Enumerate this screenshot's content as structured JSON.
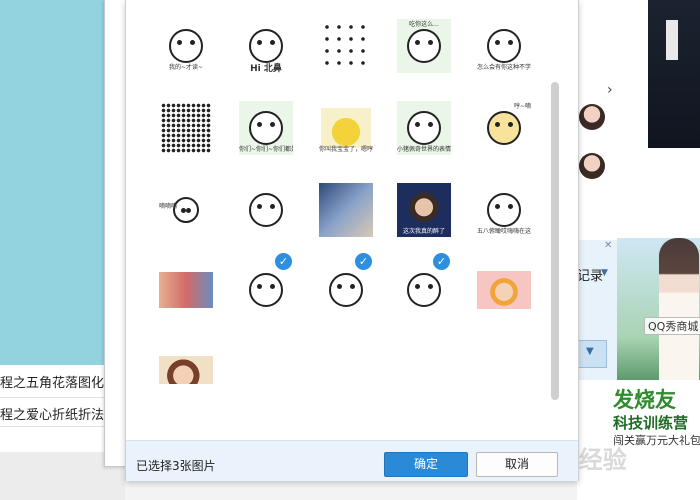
{
  "background": {
    "left_list": [
      "程之五角花落图化",
      "程之爱心折纸折法"
    ],
    "right_menu": "记录",
    "right_ad_label": "QQ秀商城",
    "promo_title": "发烧友",
    "promo_subtitle": "科技训练营",
    "promo_line": "闯关赢万元大礼包",
    "watermark": "Bai经验"
  },
  "dialog": {
    "footer_status": "已选择3张图片",
    "ok_label": "确定",
    "cancel_label": "取消",
    "accent": "#2a8ad8"
  },
  "thumbnails": [
    {
      "id": "t1",
      "caption": "我的~才读~",
      "selected": false
    },
    {
      "id": "t2",
      "caption": "Hi 北鼻",
      "selected": false
    },
    {
      "id": "t3",
      "caption": "",
      "selected": false
    },
    {
      "id": "t4",
      "caption": "吃你这么...",
      "selected": false
    },
    {
      "id": "t5",
      "caption": "怎么会有你这种不学习的人呢?",
      "selected": false
    },
    {
      "id": "t6",
      "caption": "",
      "selected": false
    },
    {
      "id": "t7",
      "caption": "你们~你们~你们都是坏人",
      "selected": false
    },
    {
      "id": "t8",
      "caption": "你叫我宝宝了，嗯哼！",
      "selected": false
    },
    {
      "id": "t9",
      "caption": "小猪佩奇世界的表情全都是坏蛋",
      "selected": false
    },
    {
      "id": "t10",
      "caption": "哼~嘀",
      "selected": false
    },
    {
      "id": "t11",
      "caption": "嘀嘀嘀",
      "selected": false
    },
    {
      "id": "t12",
      "caption": "",
      "selected": false
    },
    {
      "id": "t13",
      "caption": "",
      "selected": false
    },
    {
      "id": "t14",
      "caption": "这次我真的醉了",
      "selected": false
    },
    {
      "id": "t15",
      "caption": "五八俯瞰哎嗨嗨在这嗨嗨的时代",
      "selected": false
    },
    {
      "id": "t16",
      "caption": "",
      "selected": false
    },
    {
      "id": "t17",
      "caption": "",
      "selected": true
    },
    {
      "id": "t18",
      "caption": "",
      "selected": true
    },
    {
      "id": "t19",
      "caption": "",
      "selected": true
    },
    {
      "id": "t20",
      "caption": "",
      "selected": false
    },
    {
      "id": "t21",
      "caption": "",
      "selected": false
    }
  ]
}
